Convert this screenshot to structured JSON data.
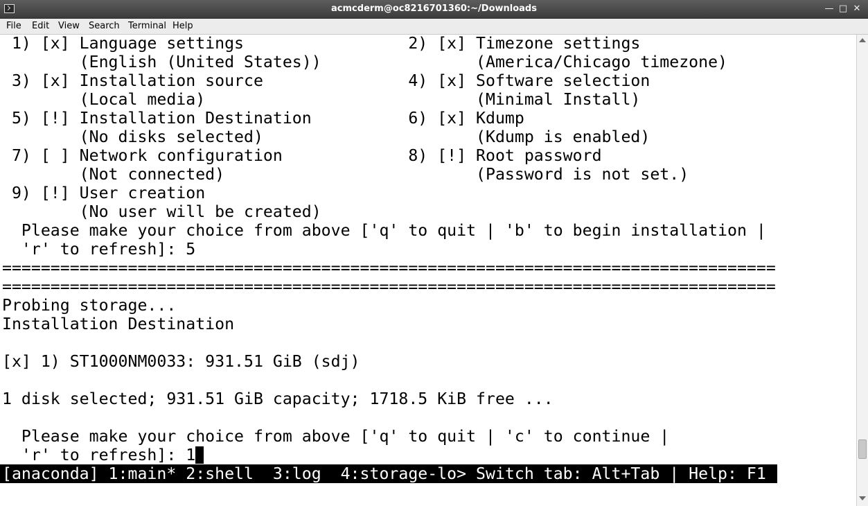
{
  "window": {
    "title": "acmcderm@oc8216701360:~/Downloads",
    "icon": "terminal-icon",
    "buttons": {
      "minimize": "—",
      "maximize": "□",
      "close": "✕"
    }
  },
  "menubar": {
    "items": [
      "File",
      "Edit",
      "View",
      "Search",
      "Terminal",
      "Help"
    ]
  },
  "terminal": {
    "lines": [
      " 1) [x] Language settings                 2) [x] Timezone settings",
      "        (English (United States))                (America/Chicago timezone)",
      " 3) [x] Installation source               4) [x] Software selection",
      "        (Local media)                            (Minimal Install)",
      " 5) [!] Installation Destination          6) [x] Kdump",
      "        (No disks selected)                      (Kdump is enabled)",
      " 7) [ ] Network configuration             8) [!] Root password",
      "        (Not connected)                          (Password is not set.)",
      " 9) [!] User creation",
      "        (No user will be created)",
      "  Please make your choice from above ['q' to quit | 'b' to begin installation |",
      "  'r' to refresh]: 5",
      "================================================================================",
      "================================================================================",
      "Probing storage...",
      "Installation Destination",
      "",
      "[x] 1) ST1000NM0033: 931.51 GiB (sdj)",
      "",
      "1 disk selected; 931.51 GiB capacity; 1718.5 KiB free ...",
      "",
      "  Please make your choice from above ['q' to quit | 'c' to continue |",
      "  'r' to refresh]: 1"
    ],
    "status_bar": "[anaconda] 1:main* 2:shell  3:log  4:storage-lo> Switch tab: Alt+Tab | Help: F1"
  },
  "colors": {
    "terminal_bg": "#ffffff",
    "terminal_fg": "#000000",
    "status_bg": "#000000",
    "status_fg": "#ffffff",
    "titlebar_bg": "#4a4a4a"
  }
}
